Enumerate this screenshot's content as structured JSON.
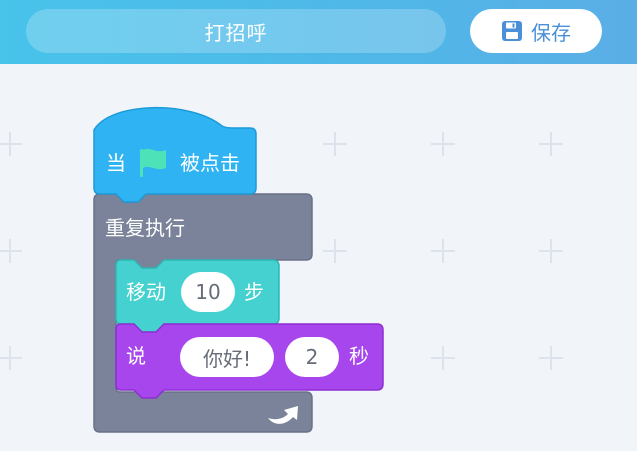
{
  "header": {
    "project_title": "打招呼",
    "save_label": "保存",
    "save_icon": "floppy-disk-icon"
  },
  "blocks": {
    "when_flag": {
      "prefix": "当",
      "icon": "green-flag-icon",
      "suffix": "被点击"
    },
    "repeat_forever": {
      "label": "重复执行",
      "icon": "loop-arrow-icon"
    },
    "move_steps": {
      "label": "移动",
      "value": "10",
      "unit": "步"
    },
    "say_for_secs": {
      "label": "说",
      "message": "你好!",
      "seconds": "2",
      "unit": "秒"
    }
  },
  "colors": {
    "header_start": "#48c3ea",
    "header_end": "#5aaee6",
    "save_text": "#4a8fd8",
    "event_block": "#2fb3f3",
    "control_block": "#7a8399",
    "motion_block": "#44d1cf",
    "looks_block": "#a746ec",
    "workspace_bg": "#f1f5fa",
    "flag_color": "#4ee2b8"
  }
}
